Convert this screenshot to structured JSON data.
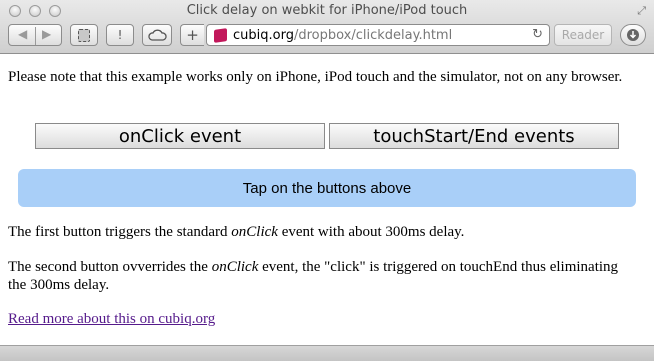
{
  "window": {
    "title": "Click delay on webkit for iPhone/iPod touch"
  },
  "toolbar": {
    "back_icon": "back-arrow-icon",
    "forward_icon": "forward-arrow-icon",
    "bookmark_icon": "reading-list-icon",
    "alert_label": "!",
    "add_label": "+",
    "reader_label": "Reader"
  },
  "address": {
    "host": "cubiq.org",
    "path": "/dropbox/clickdelay.html"
  },
  "page": {
    "note": "Please note that this example works only on iPhone, iPod touch and the simulator, not on any browser.",
    "button1": "onClick event",
    "button2": "touchStart/End events",
    "status": "Tap on the buttons above",
    "p1_before": "The first button triggers the standard ",
    "p1_em": "onClick",
    "p1_after": " event with about 300ms delay.",
    "p2_before": "The second button ovverrides the ",
    "p2_em": "onClick",
    "p2_after": " event, the \"click\" is triggered on touchEnd thus eliminating the 300ms delay.",
    "link": "Read more about this on cubiq.org"
  },
  "colors": {
    "status_bg": "#a9cff8",
    "link": "#551a8b",
    "favicon": "#c2185b"
  }
}
